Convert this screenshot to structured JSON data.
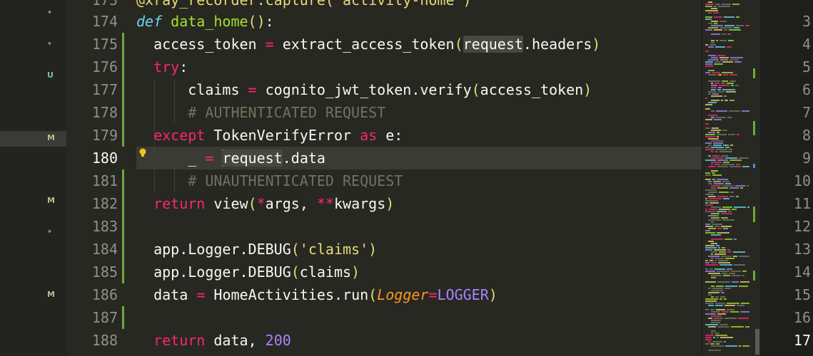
{
  "explorer": {
    "marks": [
      {
        "symbol": "•",
        "color": "#8a8a7a"
      },
      {
        "symbol": "•",
        "color": "#6a9955"
      },
      {
        "symbol": "U",
        "color": "#73c991"
      },
      {
        "symbol": "M",
        "color": "#c0b890"
      },
      {
        "symbol": "M",
        "color": "#c0b890"
      },
      {
        "symbol": "•",
        "color": "#8a8a7a"
      },
      {
        "symbol": "M",
        "color": "#c0b890"
      }
    ]
  },
  "editor": {
    "top_partial_number": "173",
    "top_partial_text": "@xray_recorder.capture('activity-home')",
    "lines": [
      {
        "number": "174"
      },
      {
        "number": "175"
      },
      {
        "number": "176"
      },
      {
        "number": "177"
      },
      {
        "number": "178"
      },
      {
        "number": "179"
      },
      {
        "number": "180"
      },
      {
        "number": "181"
      },
      {
        "number": "182"
      },
      {
        "number": "183"
      },
      {
        "number": "184"
      },
      {
        "number": "185"
      },
      {
        "number": "186"
      },
      {
        "number": "187"
      },
      {
        "number": "188"
      }
    ],
    "tokens": {
      "def": "def",
      "data_home": "data_home",
      "p_open": "(",
      "p_close": ")",
      "colon": ":",
      "access_token": "access_token",
      "eq": "=",
      "extract_access_token": "extract_access_token",
      "request": "request",
      "dot_headers": ".headers",
      "try": "try",
      "claims": "claims",
      "cognito_verify": "cognito_jwt_token.verify",
      "comment_auth": "# AUTHENTICATED REQUEST",
      "except": "except",
      "TokenVerifyError": "TokenVerifyError",
      "as": "as",
      "e_colon": "e:",
      "underscore": "_",
      "dot_data": ".data",
      "comment_unauth": "# UNAUTHENTICATED REQUEST",
      "return": "return",
      "view": "view",
      "star": "*",
      "args_comma": "args, ",
      "dstar": "**",
      "kwargs": "kwargs",
      "app_logger_debug": "app.Logger.DEBUG",
      "str_claims": "'claims'",
      "data": "data",
      "homeactivities_run": "HomeActivities.run",
      "Logger": "Logger",
      "LOGGER": "LOGGER",
      "comma_space": ", ",
      "num_200": "200"
    },
    "current_line": "180"
  },
  "right_panel": {
    "line_numbers": [
      "3",
      "4",
      "5",
      "6",
      "7",
      "8",
      "9",
      "10",
      "11",
      "12",
      "13",
      "14",
      "15",
      "16",
      "17"
    ],
    "active": "17"
  },
  "colors": {
    "background": "#272822",
    "keyword": "#f92672",
    "function": "#a6e22e",
    "string": "#e6db74",
    "number": "#ae81ff",
    "comment": "#75715e",
    "change_bar": "#6fa83a"
  }
}
